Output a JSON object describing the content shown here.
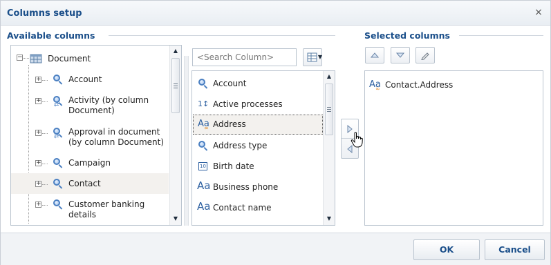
{
  "dialog": {
    "title": "Columns setup",
    "close_label": "×"
  },
  "available": {
    "label": "Available columns",
    "tree_root": "Document",
    "tree_items": [
      {
        "label": "Account"
      },
      {
        "label": "Activity (by column\nDocument)",
        "line1": "Activity (by column",
        "line2": "Document)"
      },
      {
        "label": "Approval in document\n(by column Document)",
        "line1": "Approval in document",
        "line2": "(by column Document)"
      },
      {
        "label": "Campaign"
      },
      {
        "label": "Contact"
      },
      {
        "label": "Customer banking\ndetails",
        "line1": "Customer banking",
        "line2": "details"
      }
    ]
  },
  "middle": {
    "search_placeholder": "<Search Column>",
    "items": [
      {
        "label": "Account",
        "icon": "lookup-icon"
      },
      {
        "label": "Active processes",
        "icon": "number-icon"
      },
      {
        "label": "Address",
        "icon": "text-link-icon"
      },
      {
        "label": "Address type",
        "icon": "lookup-icon"
      },
      {
        "label": "Birth date",
        "icon": "date-icon"
      },
      {
        "label": "Business phone",
        "icon": "text-icon"
      },
      {
        "label": "Contact name",
        "icon": "text-icon"
      }
    ],
    "number_icon_text": "1↕",
    "date_icon_text": "10",
    "text_icon_text": "Aa"
  },
  "selected": {
    "label": "Selected columns",
    "items": [
      {
        "label": "Contact.Address",
        "icon": "text-link-icon"
      }
    ]
  },
  "footer": {
    "ok_label": "OK",
    "cancel_label": "Cancel"
  },
  "colors": {
    "accent": "#1b4f8a",
    "selected_row": "#f3f1ee",
    "border": "#b9c3ce"
  }
}
